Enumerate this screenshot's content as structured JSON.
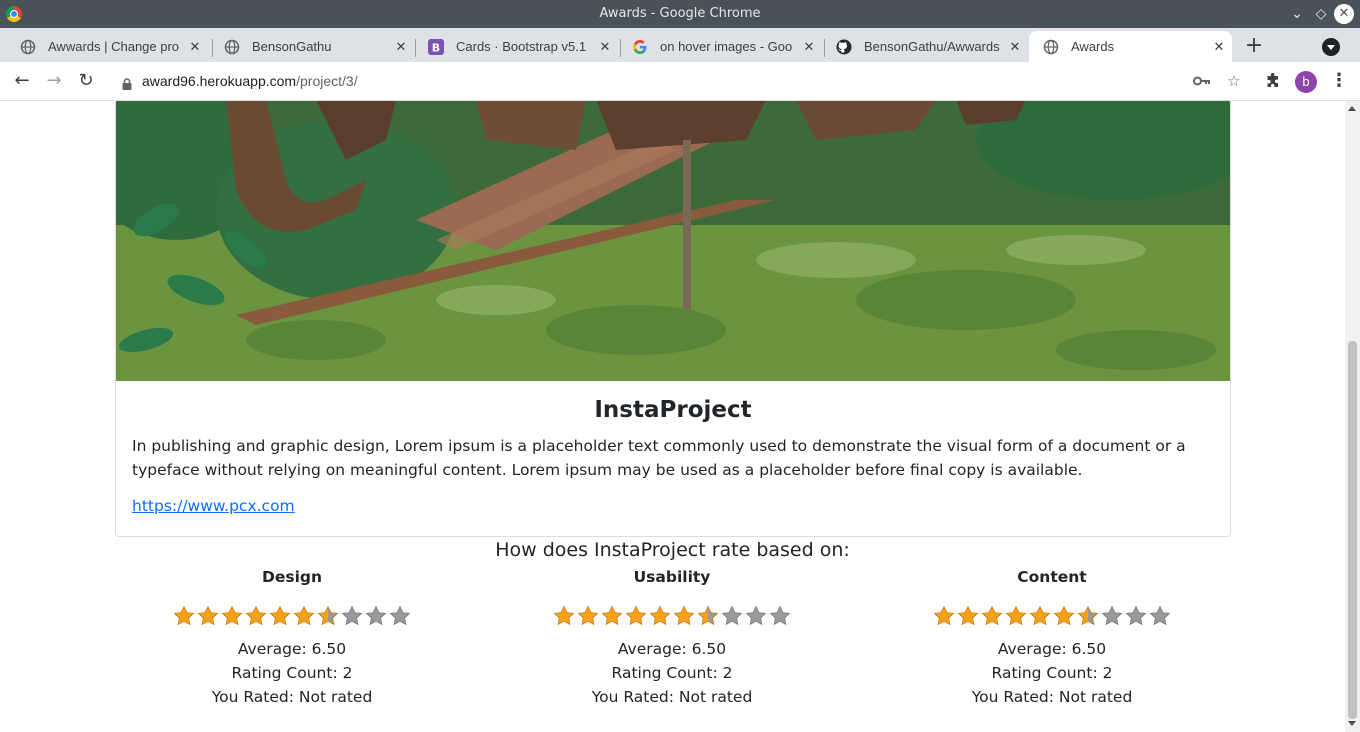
{
  "window": {
    "title": "Awards - Google Chrome"
  },
  "tabs": [
    {
      "label": "Awwards | Change pro",
      "icon": "globe-icon"
    },
    {
      "label": "BensonGathu",
      "icon": "globe-icon"
    },
    {
      "label": "Cards · Bootstrap v5.1",
      "icon": "bootstrap-icon"
    },
    {
      "label": "on hover images - Goo",
      "icon": "google-icon"
    },
    {
      "label": "BensonGathu/Awwards",
      "icon": "github-icon"
    },
    {
      "label": "Awards",
      "icon": "globe-icon",
      "active": true
    }
  ],
  "address": {
    "domain": "award96.herokuapp.com",
    "path": "/project/3/"
  },
  "profile": {
    "initial": "b",
    "color": "#8e44ad"
  },
  "project": {
    "title": "InstaProject",
    "description": "In publishing and graphic design, Lorem ipsum is a placeholder text commonly used to demonstrate the visual form of a document or a typeface without relying on meaningful content. Lorem ipsum may be used as a placeholder before final copy is available.",
    "link": "https://www.pcx.com"
  },
  "ratings": {
    "heading": "How does InstaProject rate based on:",
    "max_stars": 10,
    "categories": [
      {
        "name": "Design",
        "stars": 6.5,
        "average": "Average: 6.50",
        "count": "Rating Count: 2",
        "you_rated": "You Rated: Not rated"
      },
      {
        "name": "Usability",
        "stars": 6.5,
        "average": "Average: 6.50",
        "count": "Rating Count: 2",
        "you_rated": "You Rated: Not rated"
      },
      {
        "name": "Content",
        "stars": 6.5,
        "average": "Average: 6.50",
        "count": "Rating Count: 2",
        "you_rated": "You Rated: Not rated"
      }
    ]
  },
  "colors": {
    "link": "#0d6efd",
    "star_filled": "#f7a21b",
    "star_empty": "#9a9a9a"
  }
}
